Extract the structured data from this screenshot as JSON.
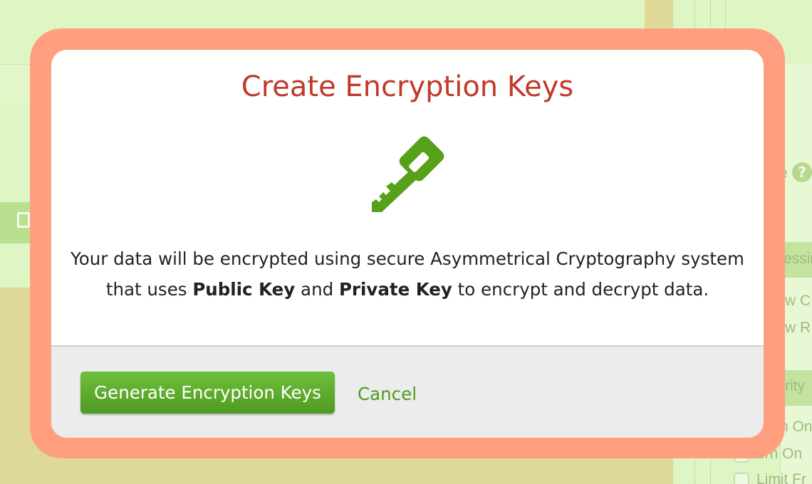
{
  "background": {
    "right_texts": [
      {
        "id": "e",
        "text": "e"
      },
      {
        "id": "essing",
        "text": "essin"
      },
      {
        "id": "w1",
        "text": "w C"
      },
      {
        "id": "w2",
        "text": "w R"
      },
      {
        "id": "rity",
        "text": "rity"
      },
      {
        "id": "turn1",
        "text": "rn On"
      },
      {
        "id": "turn2",
        "text": "urn On"
      },
      {
        "id": "limit",
        "text": "Limit Fr"
      }
    ],
    "help_glyph": "?"
  },
  "modal": {
    "title": "Create Encryption Keys",
    "icon": "key-icon",
    "description_prefix": "Your data will be encrypted using secure Asymmetrical Cryptography system that uses ",
    "public_key": "Public Key",
    "and": " and ",
    "private_key": "Private Key",
    "description_suffix": " to encrypt and decrypt data.",
    "generate_button": "Generate Encryption Keys",
    "cancel_button": "Cancel"
  },
  "colors": {
    "frame": "#ff9f80",
    "title": "#c0392b",
    "primary_green": "#5aa82b",
    "footer_bg": "#ececec"
  }
}
